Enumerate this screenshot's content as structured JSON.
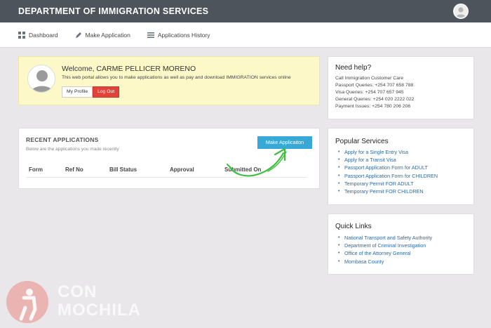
{
  "header": {
    "title": "DEPARTMENT OF IMMIGRATION SERVICES"
  },
  "nav": [
    {
      "label": "Dashboard",
      "icon": "dashboard-icon"
    },
    {
      "label": "Make Application",
      "icon": "pencil-icon"
    },
    {
      "label": "Applications History",
      "icon": "list-icon"
    }
  ],
  "welcome": {
    "heading": "Welcome, CARME PELLICER MORENO",
    "description": "This web portal allows you to make applications as well as pay and download IMMIGRATION services online",
    "profile_button": "My Profile",
    "logout_button": "Log Out"
  },
  "recent": {
    "title": "RECENT APPLICATIONS",
    "subtitle": "Below are the applications you made recently",
    "make_button": "Make Applicaiton",
    "columns": [
      "Form",
      "Ref No",
      "Bill Status",
      "Approval",
      "Submitted On"
    ]
  },
  "help": {
    "title": "Need help?",
    "lines": [
      "Call Immigration Customer Care",
      "Passport Queries: +254 707 658 788",
      "Visa Queries: +254 707 657 945",
      "General Queries: +254 020 2222 022",
      "Payment Issues: +254 780 206 206"
    ]
  },
  "popular": {
    "title": "Popular Services",
    "links": [
      "Apply for a Single Entry Visa",
      "Apply for a Transit Visa",
      "Passport Application Form for ADULT",
      "Passport Application Form for CHILDREN",
      "Temporary Permit FOR ADULT",
      "Temporary Permit FOR CHILDREN"
    ]
  },
  "quick": {
    "title": "Quick Links",
    "links": [
      "National Transport and Safety Authority",
      "Department of Criminal Investigation",
      "Office of the Attorney General",
      "Mombasa County"
    ]
  },
  "watermark": {
    "line1": "CON",
    "line2": "MOCHILA"
  },
  "colors": {
    "topbar": "#4d545c",
    "accent": "#38a9d6",
    "danger": "#e0433b",
    "link": "#2c6aa5",
    "arrow": "#3cbf3c"
  }
}
